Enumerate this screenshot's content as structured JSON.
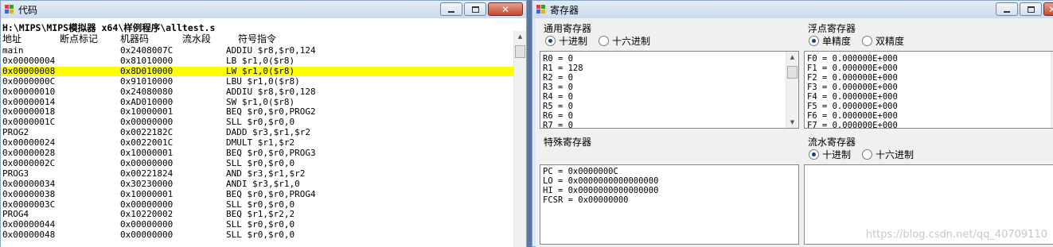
{
  "code_window": {
    "title": "代码",
    "file_path": "H:\\MIPS\\MIPS模拟器 x64\\样例程序\\alltest.s",
    "headers": {
      "address": "地址",
      "breakpoint": "断点标记",
      "machine_code": "机器码",
      "pipeline": "流水段",
      "instruction": "符号指令"
    },
    "rows": [
      {
        "addr": "main",
        "code": "0x2408007C",
        "ins": "ADDIU $r8,$r0,124",
        "highlight": false
      },
      {
        "addr": "0x00000004",
        "code": "0x81010000",
        "ins": "LB $r1,0($r8)",
        "highlight": false
      },
      {
        "addr": "0x00000008",
        "code": "0x8D010000",
        "ins": "LW $r1,0($r8)",
        "highlight": true
      },
      {
        "addr": "0x0000000C",
        "code": "0x91010000",
        "ins": "LBU $r1,0($r8)",
        "highlight": false
      },
      {
        "addr": "0x00000010",
        "code": "0x24080080",
        "ins": "ADDIU $r8,$r0,128",
        "highlight": false
      },
      {
        "addr": "0x00000014",
        "code": "0xAD010000",
        "ins": "SW $r1,0($r8)",
        "highlight": false
      },
      {
        "addr": "0x00000018",
        "code": "0x10000001",
        "ins": "BEQ $r0,$r0,PROG2",
        "highlight": false
      },
      {
        "addr": "0x0000001C",
        "code": "0x00000000",
        "ins": "SLL $r0,$r0,0",
        "highlight": false
      },
      {
        "addr": "PROG2",
        "code": "0x0022182C",
        "ins": "DADD $r3,$r1,$r2",
        "highlight": false
      },
      {
        "addr": "0x00000024",
        "code": "0x0022001C",
        "ins": "DMULT $r1,$r2",
        "highlight": false
      },
      {
        "addr": "0x00000028",
        "code": "0x10000001",
        "ins": "BEQ $r0,$r0,PROG3",
        "highlight": false
      },
      {
        "addr": "0x0000002C",
        "code": "0x00000000",
        "ins": "SLL $r0,$r0,0",
        "highlight": false
      },
      {
        "addr": "PROG3",
        "code": "0x00221824",
        "ins": "AND $r3,$r1,$r2",
        "highlight": false
      },
      {
        "addr": "0x00000034",
        "code": "0x30230000",
        "ins": "ANDI $r3,$r1,0",
        "highlight": false
      },
      {
        "addr": "0x00000038",
        "code": "0x10000001",
        "ins": "BEQ $r0,$r0,PROG4",
        "highlight": false
      },
      {
        "addr": "0x0000003C",
        "code": "0x00000000",
        "ins": "SLL $r0,$r0,0",
        "highlight": false
      },
      {
        "addr": "PROG4",
        "code": "0x10220002",
        "ins": "BEQ $r1,$r2,2",
        "highlight": false
      },
      {
        "addr": "0x00000044",
        "code": "0x00000000",
        "ins": "SLL $r0,$r0,0",
        "highlight": false
      },
      {
        "addr": "0x00000048",
        "code": "0x00000000",
        "ins": "SLL $r0,$r0,0",
        "highlight": false
      }
    ],
    "highlight_color": "#ffff00"
  },
  "register_window": {
    "title": "寄存器",
    "general": {
      "title": "通用寄存器",
      "radios": [
        {
          "label": "十进制",
          "checked": true
        },
        {
          "label": "十六进制",
          "checked": false
        }
      ],
      "lines": [
        "R0 = 0",
        "R1 = 128",
        "R2 = 0",
        "R3 = 0",
        "R4 = 0",
        "R5 = 0",
        "R6 = 0",
        "R7 = 0"
      ]
    },
    "float": {
      "title": "浮点寄存器",
      "radios": [
        {
          "label": "单精度",
          "checked": true
        },
        {
          "label": "双精度",
          "checked": false
        }
      ],
      "lines": [
        "F0 = 0.000000E+000",
        "F1 = 0.000000E+000",
        "F2 = 0.000000E+000",
        "F3 = 0.000000E+000",
        "F4 = 0.000000E+000",
        "F5 = 0.000000E+000",
        "F6 = 0.000000E+000",
        "F7 = 0.000000E+000"
      ]
    },
    "special": {
      "title": "特殊寄存器",
      "lines": [
        "PC = 0x0000000C",
        "LO = 0x0000000000000000",
        "HI = 0x0000000000000000",
        "FCSR = 0x00000000"
      ]
    },
    "pipeline": {
      "title": "流水寄存器",
      "radios": [
        {
          "label": "十进制",
          "checked": true
        },
        {
          "label": "十六进制",
          "checked": false
        }
      ],
      "lines": []
    },
    "watermark": "https://blog.csdn.net/qq_40709110"
  },
  "icons": {
    "window_icon": "app-icon",
    "minimize": "minimize-icon",
    "maximize": "maximize-icon",
    "close": "close-icon"
  },
  "colors": {
    "title_bar": "#cbdaee",
    "selection": "#ffff00",
    "window_frame": "#8aa4c8"
  }
}
